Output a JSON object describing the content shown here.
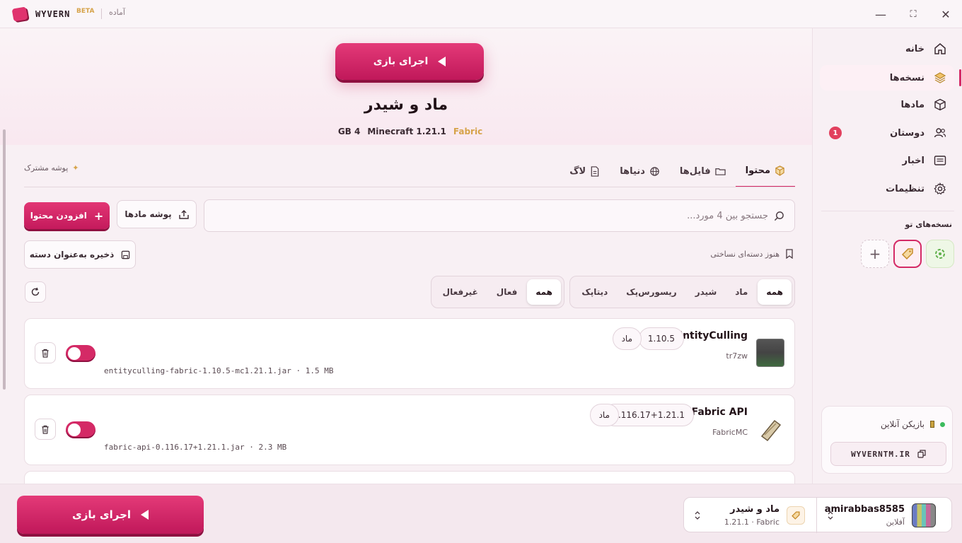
{
  "app": {
    "brand": "WYVERN",
    "beta": "BETA",
    "status": "آماده"
  },
  "window": {
    "minimize": "—",
    "maximize": "⛶",
    "close": "✕"
  },
  "sidebar": {
    "items": [
      {
        "label": "خانه"
      },
      {
        "label": "نسخه‌ها",
        "active": true
      },
      {
        "label": "مادها"
      },
      {
        "label": "دوستان",
        "badge": "1"
      },
      {
        "label": "اخبار"
      },
      {
        "label": "تنظیمات"
      }
    ],
    "instances_label": "نسخه‌های تو",
    "add_symbol": "+",
    "online": {
      "label": "بازیکن آنلاین",
      "server": "WYVERNTM.IR"
    }
  },
  "hero": {
    "play_label": "اجرای بازی",
    "title": "ماد و شیدر",
    "memory": "4 GB",
    "version": "Minecraft 1.21.1",
    "loader": "Fabric"
  },
  "toolbar": {
    "shared_folder": "پوشه مشترک",
    "tabs": [
      "محتوا",
      "فایل‌ها",
      "دنیاها",
      "لاگ"
    ],
    "add_content": "افزودن محتوا",
    "mods_folder": "پوشه مادها",
    "search_placeholder": "جستجو بین 4 مورد...",
    "save_group": "ذخیره به‌عنوان دسته",
    "no_group": "هنوز دسته‌ای نساختی",
    "type_filters": [
      "همه",
      "ماد",
      "شیدر",
      "ریسورس‌پک",
      "دیتاپک"
    ],
    "state_filters": [
      "همه",
      "فعال",
      "غیرفعال"
    ]
  },
  "mods": [
    {
      "name": "EntityCulling",
      "version": "1.10.5",
      "type": "ماد",
      "author": "tr7zw",
      "file": "entityculling-fabric-1.10.5-mc1.21.1.jar · 1.5 MB",
      "enabled": true
    },
    {
      "name": "Fabric API",
      "version": "0.116.17+1.21.1",
      "type": "ماد",
      "author": "FabricMC",
      "file": "fabric-api-0.116.17+1.21.1.jar · 2.3 MB",
      "enabled": true
    }
  ],
  "bottom": {
    "play_label": "اجرای بازی",
    "instance_name": "ماد و شیدر",
    "instance_sub": "1.21.1 · Fabric",
    "account_name": "amirabbas8585",
    "account_status": "آفلاین"
  },
  "colors": {
    "accent": "#d42a66",
    "fabric": "#d6a34a",
    "online": "#3dbb5e"
  }
}
